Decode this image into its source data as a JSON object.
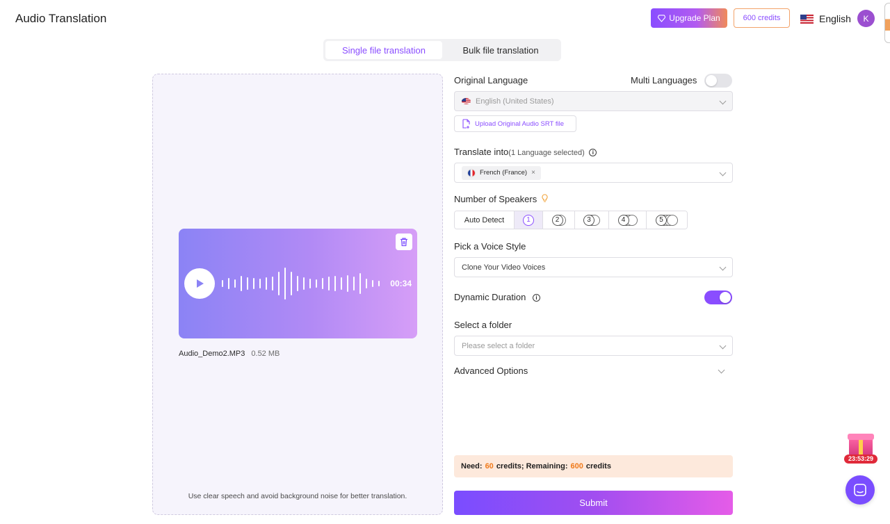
{
  "header": {
    "app_title": "Audio Translation",
    "upgrade_label": "Upgrade Plan",
    "credits_label": "600 credits",
    "language_label": "English",
    "avatar_initial": "K"
  },
  "tabs": [
    {
      "label": "Single file translation",
      "active": true
    },
    {
      "label": "Bulk file translation",
      "active": false
    }
  ],
  "audio": {
    "duration": "00:34",
    "file_name": "Audio_Demo2.MP3",
    "file_size": "0.52 MB",
    "hint": "Use clear speech and avoid background noise for better translation."
  },
  "form": {
    "original_language_label": "Original Language",
    "multi_languages_label": "Multi Languages",
    "multi_languages_on": false,
    "original_language_value": "English (United States)",
    "upload_srt_label": "Upload Original Audio SRT file",
    "translate_into_label": "Translate into",
    "translate_into_count": "(1 Language selected)",
    "target_language_chip": "French (France)",
    "speakers_label": "Number of Speakers",
    "speaker_options": [
      "Auto Detect",
      "1",
      "2",
      "3",
      "4",
      "5"
    ],
    "speaker_selected": "1",
    "voice_style_label": "Pick a Voice Style",
    "voice_style_value": "Clone Your Video Voices",
    "dynamic_duration_label": "Dynamic Duration",
    "dynamic_duration_on": true,
    "folder_label": "Select a folder",
    "folder_placeholder": "Please select a folder",
    "advanced_label": "Advanced Options"
  },
  "credits": {
    "need_label": "Need:",
    "need_value": "60",
    "remaining_label": "credits; Remaining:",
    "remaining_value": "600",
    "unit": "credits"
  },
  "submit_label": "Submit",
  "promo_timer": "23:53:29",
  "colors": {
    "accent": "#8a4dff",
    "credit_highlight": "#f07a1a"
  }
}
